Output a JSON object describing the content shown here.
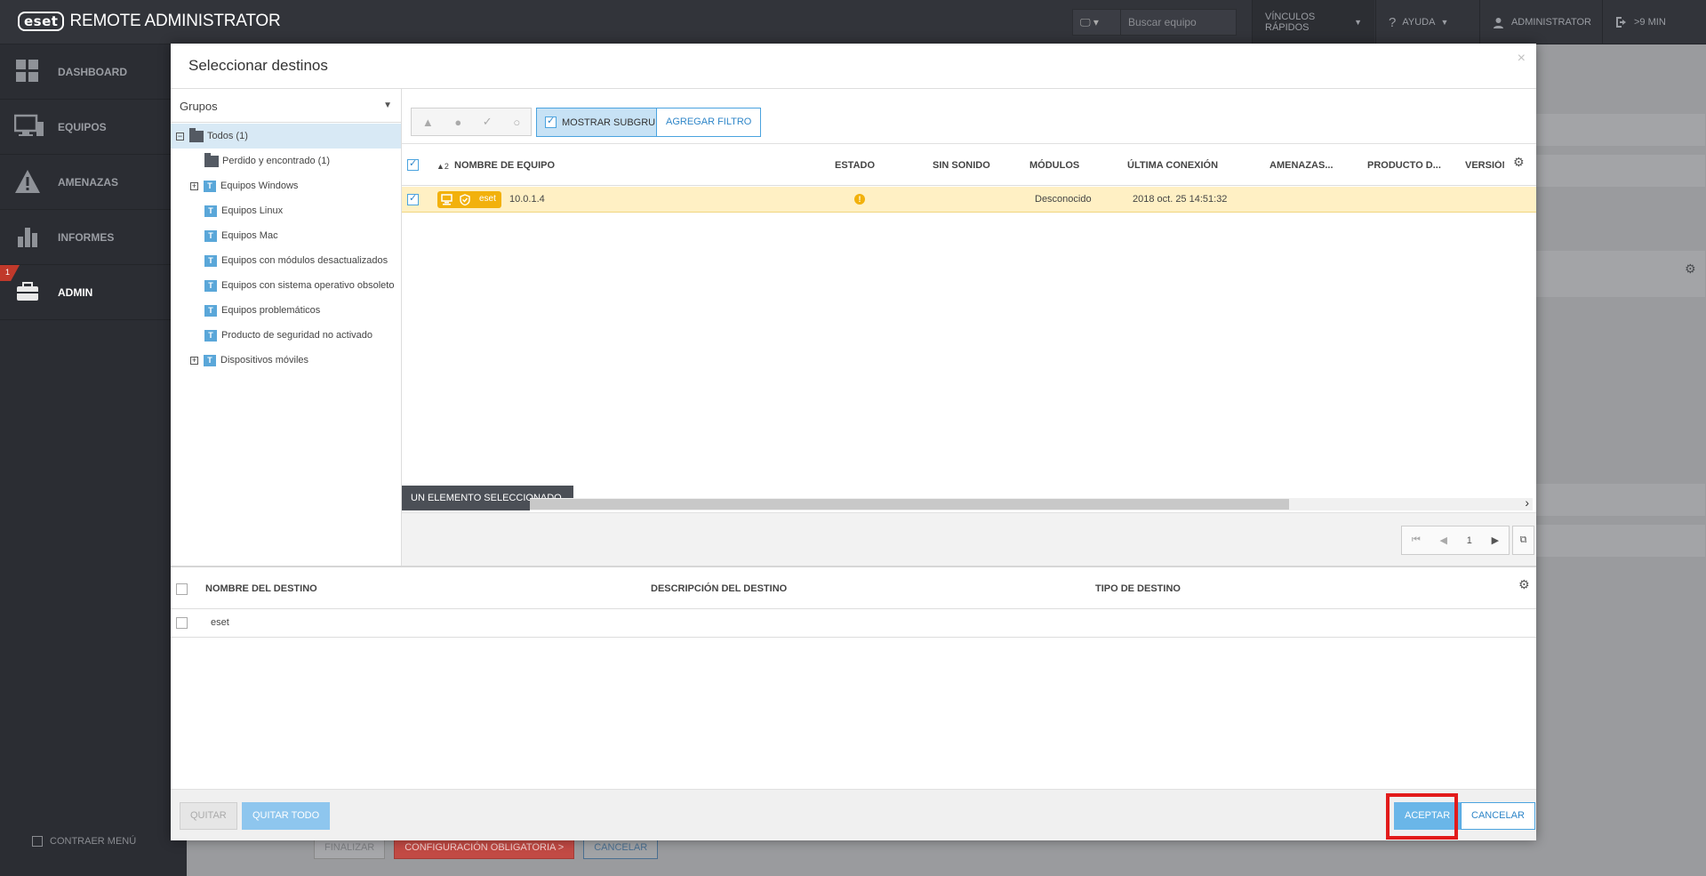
{
  "topbar": {
    "logo": "eset",
    "product": "REMOTE ADMINISTRATOR",
    "search_placeholder": "Buscar equipo",
    "quicklinks": "VÍNCULOS RÁPIDOS",
    "help": "AYUDA",
    "user": "ADMINISTRATOR",
    "session": ">9 MIN"
  },
  "sidebar": {
    "items": [
      {
        "label": "DASHBOARD",
        "icon": "dashboard-icon"
      },
      {
        "label": "EQUIPOS",
        "icon": "computer-icon"
      },
      {
        "label": "AMENAZAS",
        "icon": "warning-icon"
      },
      {
        "label": "INFORMES",
        "icon": "bar-chart-icon"
      },
      {
        "label": "ADMIN",
        "icon": "briefcase-icon",
        "badge": "1"
      }
    ],
    "collapse": "CONTRAER MENÚ"
  },
  "background_footer": {
    "finish": "FINALIZAR",
    "mandatory": "CONFIGURACIÓN OBLIGATORIA >",
    "cancel": "CANCELAR"
  },
  "modal": {
    "title": "Seleccionar destinos",
    "groups": {
      "header": "Grupos",
      "tree": [
        {
          "label": "Todos (1)",
          "type": "folder",
          "expander": "−"
        },
        {
          "label": "Perdido y encontrado (1)",
          "type": "folder"
        },
        {
          "label": "Equipos Windows",
          "type": "dynamic",
          "expander": "+"
        },
        {
          "label": "Equipos Linux",
          "type": "dynamic"
        },
        {
          "label": "Equipos Mac",
          "type": "dynamic"
        },
        {
          "label": "Equipos con módulos desactualizados",
          "type": "dynamic"
        },
        {
          "label": "Equipos con sistema operativo obsoleto",
          "type": "dynamic"
        },
        {
          "label": "Equipos problemáticos",
          "type": "dynamic"
        },
        {
          "label": "Producto de seguridad no activado",
          "type": "dynamic"
        },
        {
          "label": "Dispositivos móviles",
          "type": "dynamic",
          "expander": "+"
        }
      ]
    },
    "toolbar": {
      "status_icons": [
        "warning-icon",
        "info-icon",
        "check-icon",
        "circle-icon"
      ],
      "show_subgroups": "MOSTRAR SUBGRUPOS",
      "add_filter": "AGREGAR FILTRO"
    },
    "computers": {
      "sort_indicator": "▲2",
      "columns": [
        "NOMBRE DE EQUIPO",
        "ESTADO",
        "SIN SONIDO",
        "MÓDULOS",
        "ÚLTIMA CONEXIÓN",
        "AMENAZAS...",
        "PRODUCTO D...",
        "VERSIÓN"
      ],
      "rows": [
        {
          "tag": "eset",
          "name": "10.0.1.4",
          "modules": "Desconocido",
          "last_connection": "2018 oct. 25 14:51:32"
        }
      ],
      "selection_info": "UN ELEMENTO SELECCIONADO.",
      "page": "1"
    },
    "targets": {
      "columns": [
        "NOMBRE DEL DESTINO",
        "DESCRIPCIÓN DEL DESTINO",
        "TIPO DE DESTINO"
      ],
      "rows": [
        {
          "name": "eset"
        }
      ]
    },
    "footer": {
      "remove": "QUITAR",
      "remove_all": "QUITAR TODO",
      "accept": "ACEPTAR",
      "cancel": "CANCELAR"
    }
  },
  "colors": {
    "accent": "#4aa3df",
    "warning": "#f2b10c",
    "highlight": "#e21b1b",
    "sidebar": "#2b2d33"
  }
}
